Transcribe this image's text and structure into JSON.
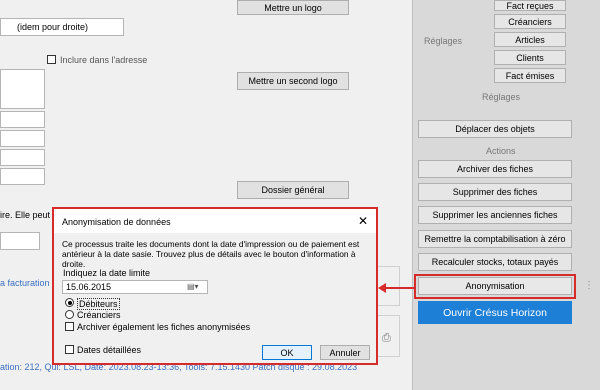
{
  "left": {
    "idem_field_value": "(idem pour droite)",
    "include_address_label": "Inclure dans l'adresse",
    "logo_button": "Mettre un logo",
    "second_logo_button": "Mettre un second logo",
    "folder_button": "Dossier général",
    "truncated_text": "ire. Elle peut",
    "billing_link": "a facturation"
  },
  "status_bar": {
    "text": "ation: 212,  Qui: LSL,  Date: 2023.08.23-13:36,  Tools: 7.15.1430    Patch disque : 29.08.2023"
  },
  "sidebar": {
    "reglages_label": "Réglages",
    "reglages_header": "Réglages",
    "actions_header": "Actions",
    "tabs": [
      "Fact reçues",
      "Créanciers",
      "Articles",
      "Clients",
      "Fact émises"
    ],
    "buttons": {
      "move_objects": "Déplacer des objets",
      "archive": "Archiver des fiches",
      "delete": "Supprimer des fiches",
      "delete_old": "Supprimer les anciennes fiches",
      "reset_accounting": "Remettre la comptabilisation à zéro",
      "recalc": "Recalculer stocks, totaux payés",
      "anonymize": "Anonymisation",
      "open_cresus": "Ouvrir Crésus Horizon"
    },
    "accent_color": "#1e7fd6",
    "highlight_color": "#d62b2b"
  },
  "dialog": {
    "title": "Anonymisation de données",
    "description": "Ce processus traite les documents dont la date d'impression ou de paiement est antérieur à la date sasie. Trouvez plus de détails avec le bouton d'information à droite.",
    "date_label": "Indiquez la date limite",
    "date_value": "15.06.2015",
    "radio_debtors": "Débiteurs",
    "radio_creditors": "Créanciers",
    "archive_checkbox": "Archiver également les fiches anonymisées",
    "detailed_dates": "Dates détaillées",
    "ok_button": "OK",
    "cancel_button": "Annuler"
  }
}
